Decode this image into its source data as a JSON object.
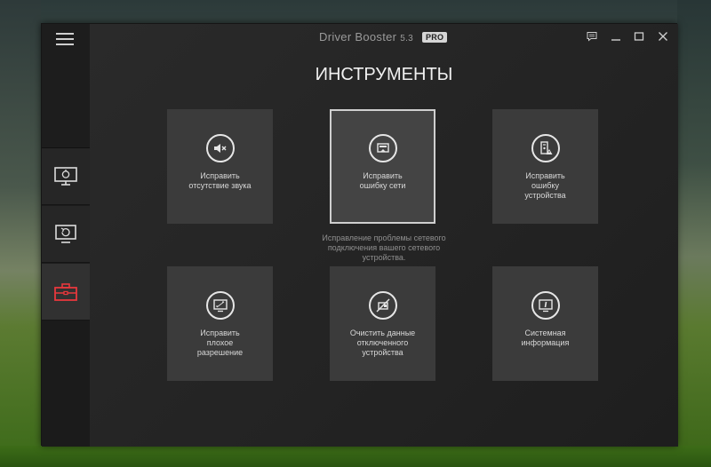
{
  "app": {
    "title": "Driver Booster",
    "version": "5.3",
    "badge": "PRO"
  },
  "page": {
    "title": "ИНСТРУМЕНТЫ"
  },
  "sidebar": {
    "items": [
      {
        "icon": "monitor-scan-icon",
        "active": false
      },
      {
        "icon": "backup-restore-icon",
        "active": false
      },
      {
        "icon": "toolbox-icon",
        "active": true
      }
    ]
  },
  "tools": [
    {
      "label": "Исправить\nотсутствие звука",
      "icon": "speaker-mute-icon"
    },
    {
      "label": "Исправить\nошибку сети",
      "icon": "network-icon",
      "selected": true
    },
    {
      "label": "Исправить\nошибку\nустройства",
      "icon": "device-warning-icon"
    },
    {
      "label": "Исправить\nплохое\nразрешение",
      "icon": "resolution-icon"
    },
    {
      "label": "Очистить данные\nотключенного\nустройства",
      "icon": "clean-device-icon"
    },
    {
      "label": "Системная\nинформация",
      "icon": "system-info-icon"
    }
  ],
  "tooltip": "Исправление проблемы сетевого\nподключения вашего сетевого\nустройства.",
  "colors": {
    "accent": "#e8383d",
    "tile": "#3b3b3b",
    "window": "#202020"
  }
}
